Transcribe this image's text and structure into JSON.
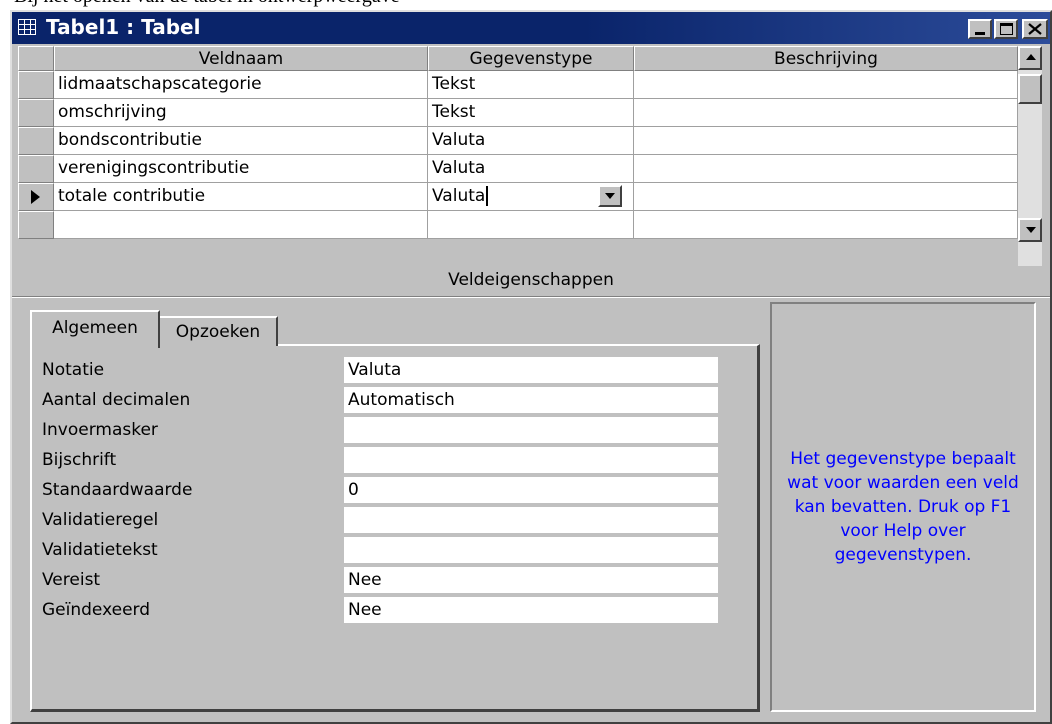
{
  "page_header_fragment": "Bij het openen van de tabel in ontwerpweergave",
  "window": {
    "title": "Tabel1 : Tabel"
  },
  "grid": {
    "headers": [
      "Veldnaam",
      "Gegevenstype",
      "Beschrijving"
    ],
    "rows": [
      {
        "name": "lidmaatschapscategorie",
        "type": "Tekst",
        "desc": ""
      },
      {
        "name": "omschrijving",
        "type": "Tekst",
        "desc": ""
      },
      {
        "name": "bondscontributie",
        "type": "Valuta",
        "desc": ""
      },
      {
        "name": "verenigingscontributie",
        "type": "Valuta",
        "desc": ""
      },
      {
        "name": "totale contributie",
        "type": "Valuta",
        "desc": "",
        "current": true
      },
      {
        "name": "",
        "type": "",
        "desc": ""
      }
    ]
  },
  "properties": {
    "section_label": "Veldeigenschappen",
    "tabs": [
      "Algemeen",
      "Opzoeken"
    ],
    "active_tab": "Algemeen",
    "fields": [
      {
        "label": "Notatie",
        "value": "Valuta"
      },
      {
        "label": "Aantal decimalen",
        "value": "Automatisch"
      },
      {
        "label": "Invoermasker",
        "value": ""
      },
      {
        "label": "Bijschrift",
        "value": ""
      },
      {
        "label": "Standaardwaarde",
        "value": "0"
      },
      {
        "label": "Validatieregel",
        "value": ""
      },
      {
        "label": "Validatietekst",
        "value": ""
      },
      {
        "label": "Vereist",
        "value": "Nee"
      },
      {
        "label": "Geïndexeerd",
        "value": "Nee"
      }
    ]
  },
  "help_text": "Het gegevenstype bepaalt wat voor waarden een veld kan bevatten. Druk op F1 voor Help over gegevenstypen.",
  "colors": {
    "titlebar": "#0a246a",
    "help_text": "#0000ff",
    "face": "#c0c0c0"
  }
}
